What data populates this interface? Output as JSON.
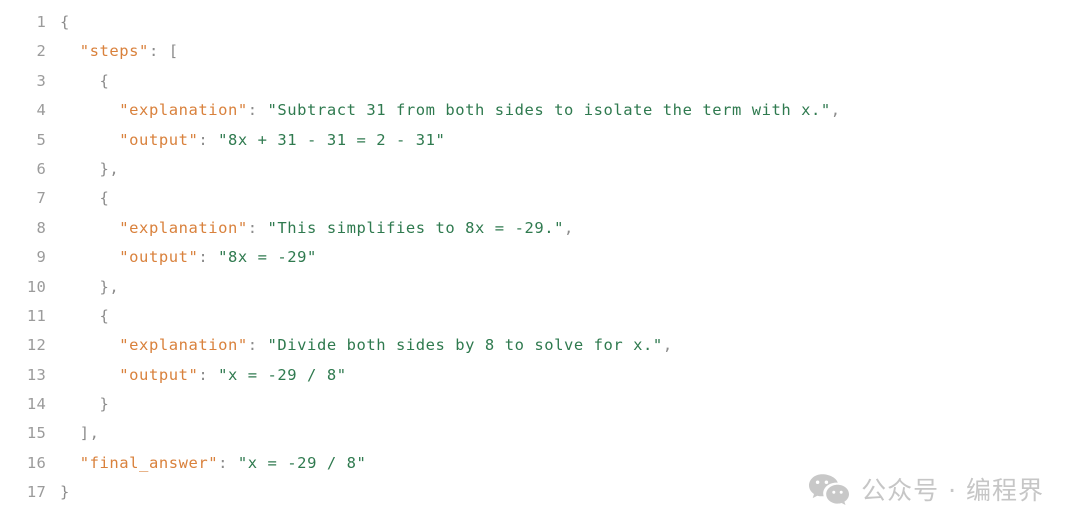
{
  "editor": {
    "language": "json",
    "background_color": "#ffffff",
    "gutter_color": "#9b9b9b",
    "colors": {
      "key": "#d9813c",
      "string": "#2f7a4f",
      "punctuation": "#8c8c8c"
    },
    "line_numbers": [
      "1",
      "2",
      "3",
      "4",
      "5",
      "6",
      "7",
      "8",
      "9",
      "10",
      "11",
      "12",
      "13",
      "14",
      "15",
      "16",
      "17"
    ],
    "lines": [
      {
        "n": "1",
        "indent": "",
        "tokens": [
          {
            "t": "punct",
            "v": "{"
          }
        ]
      },
      {
        "n": "2",
        "indent": "  ",
        "tokens": [
          {
            "t": "key",
            "v": "\"steps\""
          },
          {
            "t": "punct",
            "v": ": ["
          }
        ]
      },
      {
        "n": "3",
        "indent": "    ",
        "tokens": [
          {
            "t": "punct",
            "v": "{"
          }
        ]
      },
      {
        "n": "4",
        "indent": "      ",
        "tokens": [
          {
            "t": "key",
            "v": "\"explanation\""
          },
          {
            "t": "punct",
            "v": ": "
          },
          {
            "t": "string",
            "v": "\"Subtract 31 from both sides to isolate the term with x.\""
          },
          {
            "t": "punct",
            "v": ","
          }
        ]
      },
      {
        "n": "5",
        "indent": "      ",
        "tokens": [
          {
            "t": "key",
            "v": "\"output\""
          },
          {
            "t": "punct",
            "v": ": "
          },
          {
            "t": "string",
            "v": "\"8x + 31 - 31 = 2 - 31\""
          }
        ]
      },
      {
        "n": "6",
        "indent": "    ",
        "tokens": [
          {
            "t": "punct",
            "v": "},"
          }
        ]
      },
      {
        "n": "7",
        "indent": "    ",
        "tokens": [
          {
            "t": "punct",
            "v": "{"
          }
        ]
      },
      {
        "n": "8",
        "indent": "      ",
        "tokens": [
          {
            "t": "key",
            "v": "\"explanation\""
          },
          {
            "t": "punct",
            "v": ": "
          },
          {
            "t": "string",
            "v": "\"This simplifies to 8x = -29.\""
          },
          {
            "t": "punct",
            "v": ","
          }
        ]
      },
      {
        "n": "9",
        "indent": "      ",
        "tokens": [
          {
            "t": "key",
            "v": "\"output\""
          },
          {
            "t": "punct",
            "v": ": "
          },
          {
            "t": "string",
            "v": "\"8x = -29\""
          }
        ]
      },
      {
        "n": "10",
        "indent": "    ",
        "tokens": [
          {
            "t": "punct",
            "v": "},"
          }
        ]
      },
      {
        "n": "11",
        "indent": "    ",
        "tokens": [
          {
            "t": "punct",
            "v": "{"
          }
        ]
      },
      {
        "n": "12",
        "indent": "      ",
        "tokens": [
          {
            "t": "key",
            "v": "\"explanation\""
          },
          {
            "t": "punct",
            "v": ": "
          },
          {
            "t": "string",
            "v": "\"Divide both sides by 8 to solve for x.\""
          },
          {
            "t": "punct",
            "v": ","
          }
        ]
      },
      {
        "n": "13",
        "indent": "      ",
        "tokens": [
          {
            "t": "key",
            "v": "\"output\""
          },
          {
            "t": "punct",
            "v": ": "
          },
          {
            "t": "string",
            "v": "\"x = -29 / 8\""
          }
        ]
      },
      {
        "n": "14",
        "indent": "    ",
        "tokens": [
          {
            "t": "punct",
            "v": "}"
          }
        ]
      },
      {
        "n": "15",
        "indent": "  ",
        "tokens": [
          {
            "t": "punct",
            "v": "],"
          }
        ]
      },
      {
        "n": "16",
        "indent": "  ",
        "tokens": [
          {
            "t": "key",
            "v": "\"final_answer\""
          },
          {
            "t": "punct",
            "v": ": "
          },
          {
            "t": "string",
            "v": "\"x = -29 / 8\""
          }
        ]
      },
      {
        "n": "17",
        "indent": "",
        "tokens": [
          {
            "t": "punct",
            "v": "}"
          }
        ]
      }
    ]
  },
  "watermark": {
    "icon": "wechat-icon",
    "text": "公众号 · 编程界",
    "color": "#c6c6c6"
  }
}
